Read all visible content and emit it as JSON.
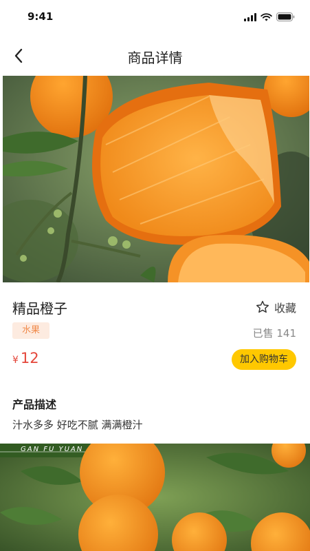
{
  "status_bar": {
    "time": "9:41"
  },
  "nav": {
    "title": "商品详情"
  },
  "product": {
    "name": "精品橙子",
    "favorite_label": "收藏",
    "tag": "水果",
    "sold": "已售 141",
    "currency": "¥",
    "price": "12",
    "add_to_cart": "加入购物车"
  },
  "description": {
    "title": "产品描述",
    "text": "汁水多多 好吃不腻 满满橙汁"
  },
  "photo2": {
    "banner": "GAN FU YUAN"
  },
  "colors": {
    "accent": "#ffc800",
    "price": "#e4463a",
    "tag_bg": "#fdebe0",
    "tag_text": "#f08a4b"
  },
  "icons": [
    "back-arrow-icon",
    "star-icon",
    "signal-icon",
    "wifi-icon",
    "battery-icon"
  ]
}
